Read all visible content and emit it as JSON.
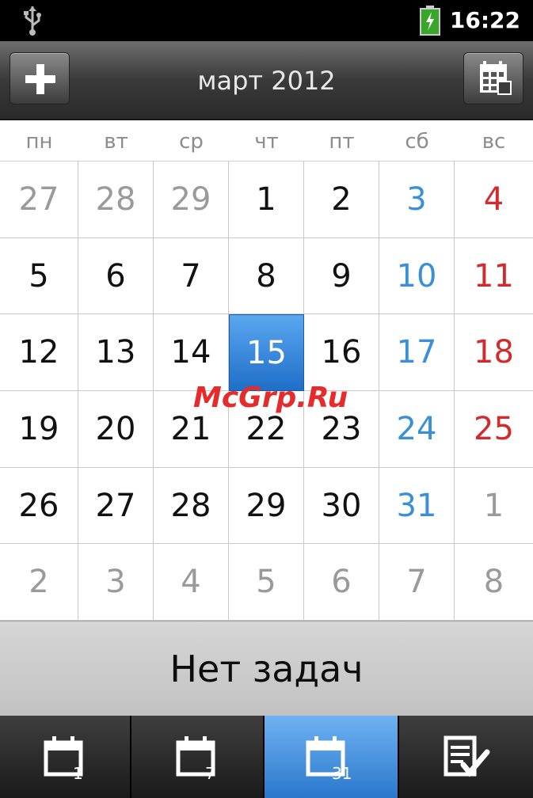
{
  "status_bar": {
    "time": "16:22",
    "icons": [
      "usb-icon",
      "battery-charging-icon"
    ]
  },
  "header": {
    "title": "март 2012",
    "add_icon": "plus-icon",
    "calendar_icon": "calendar-grid-icon"
  },
  "weekdays": [
    "пн",
    "вт",
    "ср",
    "чт",
    "пт",
    "сб",
    "вс"
  ],
  "calendar": {
    "weeks": [
      [
        {
          "d": "27",
          "t": "muted"
        },
        {
          "d": "28",
          "t": "muted"
        },
        {
          "d": "29",
          "t": "muted"
        },
        {
          "d": "1",
          "t": "normal"
        },
        {
          "d": "2",
          "t": "normal"
        },
        {
          "d": "3",
          "t": "sat"
        },
        {
          "d": "4",
          "t": "sun"
        }
      ],
      [
        {
          "d": "5",
          "t": "normal"
        },
        {
          "d": "6",
          "t": "normal"
        },
        {
          "d": "7",
          "t": "normal"
        },
        {
          "d": "8",
          "t": "normal"
        },
        {
          "d": "9",
          "t": "normal"
        },
        {
          "d": "10",
          "t": "sat"
        },
        {
          "d": "11",
          "t": "sun"
        }
      ],
      [
        {
          "d": "12",
          "t": "normal"
        },
        {
          "d": "13",
          "t": "normal"
        },
        {
          "d": "14",
          "t": "normal"
        },
        {
          "d": "15",
          "t": "today"
        },
        {
          "d": "16",
          "t": "normal"
        },
        {
          "d": "17",
          "t": "sat"
        },
        {
          "d": "18",
          "t": "sun"
        }
      ],
      [
        {
          "d": "19",
          "t": "normal"
        },
        {
          "d": "20",
          "t": "normal"
        },
        {
          "d": "21",
          "t": "normal"
        },
        {
          "d": "22",
          "t": "normal"
        },
        {
          "d": "23",
          "t": "normal"
        },
        {
          "d": "24",
          "t": "sat"
        },
        {
          "d": "25",
          "t": "sun"
        }
      ],
      [
        {
          "d": "26",
          "t": "normal"
        },
        {
          "d": "27",
          "t": "normal"
        },
        {
          "d": "28",
          "t": "normal"
        },
        {
          "d": "29",
          "t": "normal"
        },
        {
          "d": "30",
          "t": "normal"
        },
        {
          "d": "31",
          "t": "sat"
        },
        {
          "d": "1",
          "t": "muted"
        }
      ],
      [
        {
          "d": "2",
          "t": "muted"
        },
        {
          "d": "3",
          "t": "muted"
        },
        {
          "d": "4",
          "t": "muted"
        },
        {
          "d": "5",
          "t": "muted"
        },
        {
          "d": "6",
          "t": "muted"
        },
        {
          "d": "7",
          "t": "muted"
        },
        {
          "d": "8",
          "t": "muted"
        }
      ]
    ],
    "selected_day": "15"
  },
  "tasks": {
    "empty_text": "Нет задач"
  },
  "tabs": [
    {
      "icon": "calendar-day-icon",
      "number": "1",
      "active": false
    },
    {
      "icon": "calendar-week-icon",
      "number": "7",
      "active": false
    },
    {
      "icon": "calendar-month-icon",
      "number": "31",
      "active": true
    },
    {
      "icon": "task-list-icon",
      "number": "",
      "active": false
    }
  ],
  "watermark": "McGrp.Ru",
  "colors": {
    "accent": "#2a78cc",
    "saturday": "#3a8fd6",
    "sunday": "#d32b2b",
    "muted": "#9a9a9a"
  }
}
